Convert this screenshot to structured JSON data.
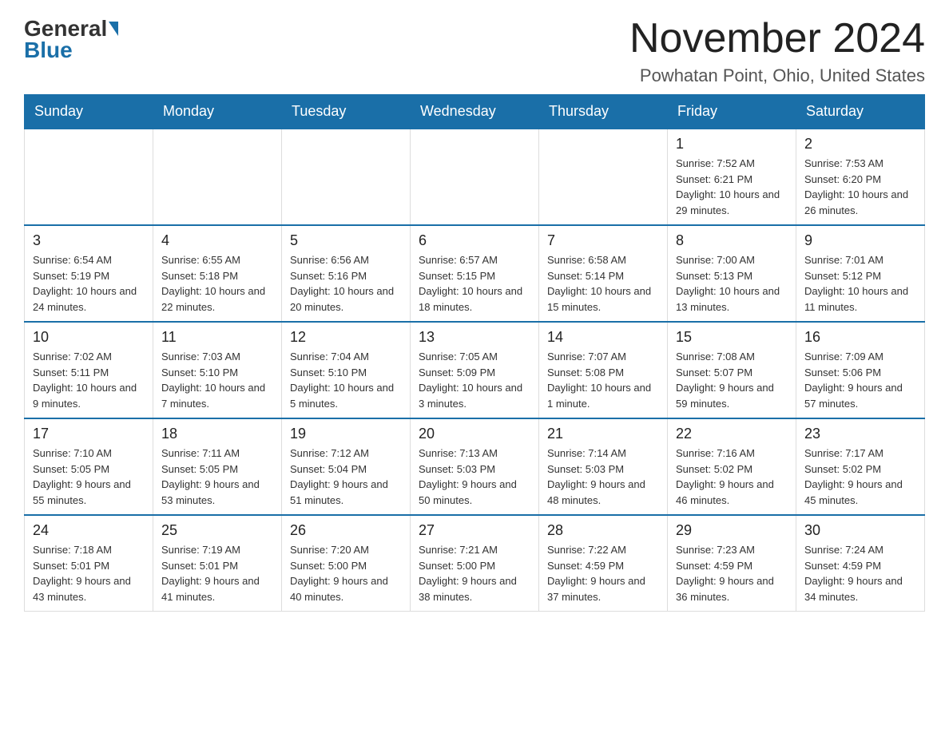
{
  "logo": {
    "general": "General",
    "blue": "Blue"
  },
  "title": "November 2024",
  "location": "Powhatan Point, Ohio, United States",
  "days_of_week": [
    "Sunday",
    "Monday",
    "Tuesday",
    "Wednesday",
    "Thursday",
    "Friday",
    "Saturday"
  ],
  "weeks": [
    [
      {
        "day": "",
        "info": ""
      },
      {
        "day": "",
        "info": ""
      },
      {
        "day": "",
        "info": ""
      },
      {
        "day": "",
        "info": ""
      },
      {
        "day": "",
        "info": ""
      },
      {
        "day": "1",
        "info": "Sunrise: 7:52 AM\nSunset: 6:21 PM\nDaylight: 10 hours and 29 minutes."
      },
      {
        "day": "2",
        "info": "Sunrise: 7:53 AM\nSunset: 6:20 PM\nDaylight: 10 hours and 26 minutes."
      }
    ],
    [
      {
        "day": "3",
        "info": "Sunrise: 6:54 AM\nSunset: 5:19 PM\nDaylight: 10 hours and 24 minutes."
      },
      {
        "day": "4",
        "info": "Sunrise: 6:55 AM\nSunset: 5:18 PM\nDaylight: 10 hours and 22 minutes."
      },
      {
        "day": "5",
        "info": "Sunrise: 6:56 AM\nSunset: 5:16 PM\nDaylight: 10 hours and 20 minutes."
      },
      {
        "day": "6",
        "info": "Sunrise: 6:57 AM\nSunset: 5:15 PM\nDaylight: 10 hours and 18 minutes."
      },
      {
        "day": "7",
        "info": "Sunrise: 6:58 AM\nSunset: 5:14 PM\nDaylight: 10 hours and 15 minutes."
      },
      {
        "day": "8",
        "info": "Sunrise: 7:00 AM\nSunset: 5:13 PM\nDaylight: 10 hours and 13 minutes."
      },
      {
        "day": "9",
        "info": "Sunrise: 7:01 AM\nSunset: 5:12 PM\nDaylight: 10 hours and 11 minutes."
      }
    ],
    [
      {
        "day": "10",
        "info": "Sunrise: 7:02 AM\nSunset: 5:11 PM\nDaylight: 10 hours and 9 minutes."
      },
      {
        "day": "11",
        "info": "Sunrise: 7:03 AM\nSunset: 5:10 PM\nDaylight: 10 hours and 7 minutes."
      },
      {
        "day": "12",
        "info": "Sunrise: 7:04 AM\nSunset: 5:10 PM\nDaylight: 10 hours and 5 minutes."
      },
      {
        "day": "13",
        "info": "Sunrise: 7:05 AM\nSunset: 5:09 PM\nDaylight: 10 hours and 3 minutes."
      },
      {
        "day": "14",
        "info": "Sunrise: 7:07 AM\nSunset: 5:08 PM\nDaylight: 10 hours and 1 minute."
      },
      {
        "day": "15",
        "info": "Sunrise: 7:08 AM\nSunset: 5:07 PM\nDaylight: 9 hours and 59 minutes."
      },
      {
        "day": "16",
        "info": "Sunrise: 7:09 AM\nSunset: 5:06 PM\nDaylight: 9 hours and 57 minutes."
      }
    ],
    [
      {
        "day": "17",
        "info": "Sunrise: 7:10 AM\nSunset: 5:05 PM\nDaylight: 9 hours and 55 minutes."
      },
      {
        "day": "18",
        "info": "Sunrise: 7:11 AM\nSunset: 5:05 PM\nDaylight: 9 hours and 53 minutes."
      },
      {
        "day": "19",
        "info": "Sunrise: 7:12 AM\nSunset: 5:04 PM\nDaylight: 9 hours and 51 minutes."
      },
      {
        "day": "20",
        "info": "Sunrise: 7:13 AM\nSunset: 5:03 PM\nDaylight: 9 hours and 50 minutes."
      },
      {
        "day": "21",
        "info": "Sunrise: 7:14 AM\nSunset: 5:03 PM\nDaylight: 9 hours and 48 minutes."
      },
      {
        "day": "22",
        "info": "Sunrise: 7:16 AM\nSunset: 5:02 PM\nDaylight: 9 hours and 46 minutes."
      },
      {
        "day": "23",
        "info": "Sunrise: 7:17 AM\nSunset: 5:02 PM\nDaylight: 9 hours and 45 minutes."
      }
    ],
    [
      {
        "day": "24",
        "info": "Sunrise: 7:18 AM\nSunset: 5:01 PM\nDaylight: 9 hours and 43 minutes."
      },
      {
        "day": "25",
        "info": "Sunrise: 7:19 AM\nSunset: 5:01 PM\nDaylight: 9 hours and 41 minutes."
      },
      {
        "day": "26",
        "info": "Sunrise: 7:20 AM\nSunset: 5:00 PM\nDaylight: 9 hours and 40 minutes."
      },
      {
        "day": "27",
        "info": "Sunrise: 7:21 AM\nSunset: 5:00 PM\nDaylight: 9 hours and 38 minutes."
      },
      {
        "day": "28",
        "info": "Sunrise: 7:22 AM\nSunset: 4:59 PM\nDaylight: 9 hours and 37 minutes."
      },
      {
        "day": "29",
        "info": "Sunrise: 7:23 AM\nSunset: 4:59 PM\nDaylight: 9 hours and 36 minutes."
      },
      {
        "day": "30",
        "info": "Sunrise: 7:24 AM\nSunset: 4:59 PM\nDaylight: 9 hours and 34 minutes."
      }
    ]
  ]
}
